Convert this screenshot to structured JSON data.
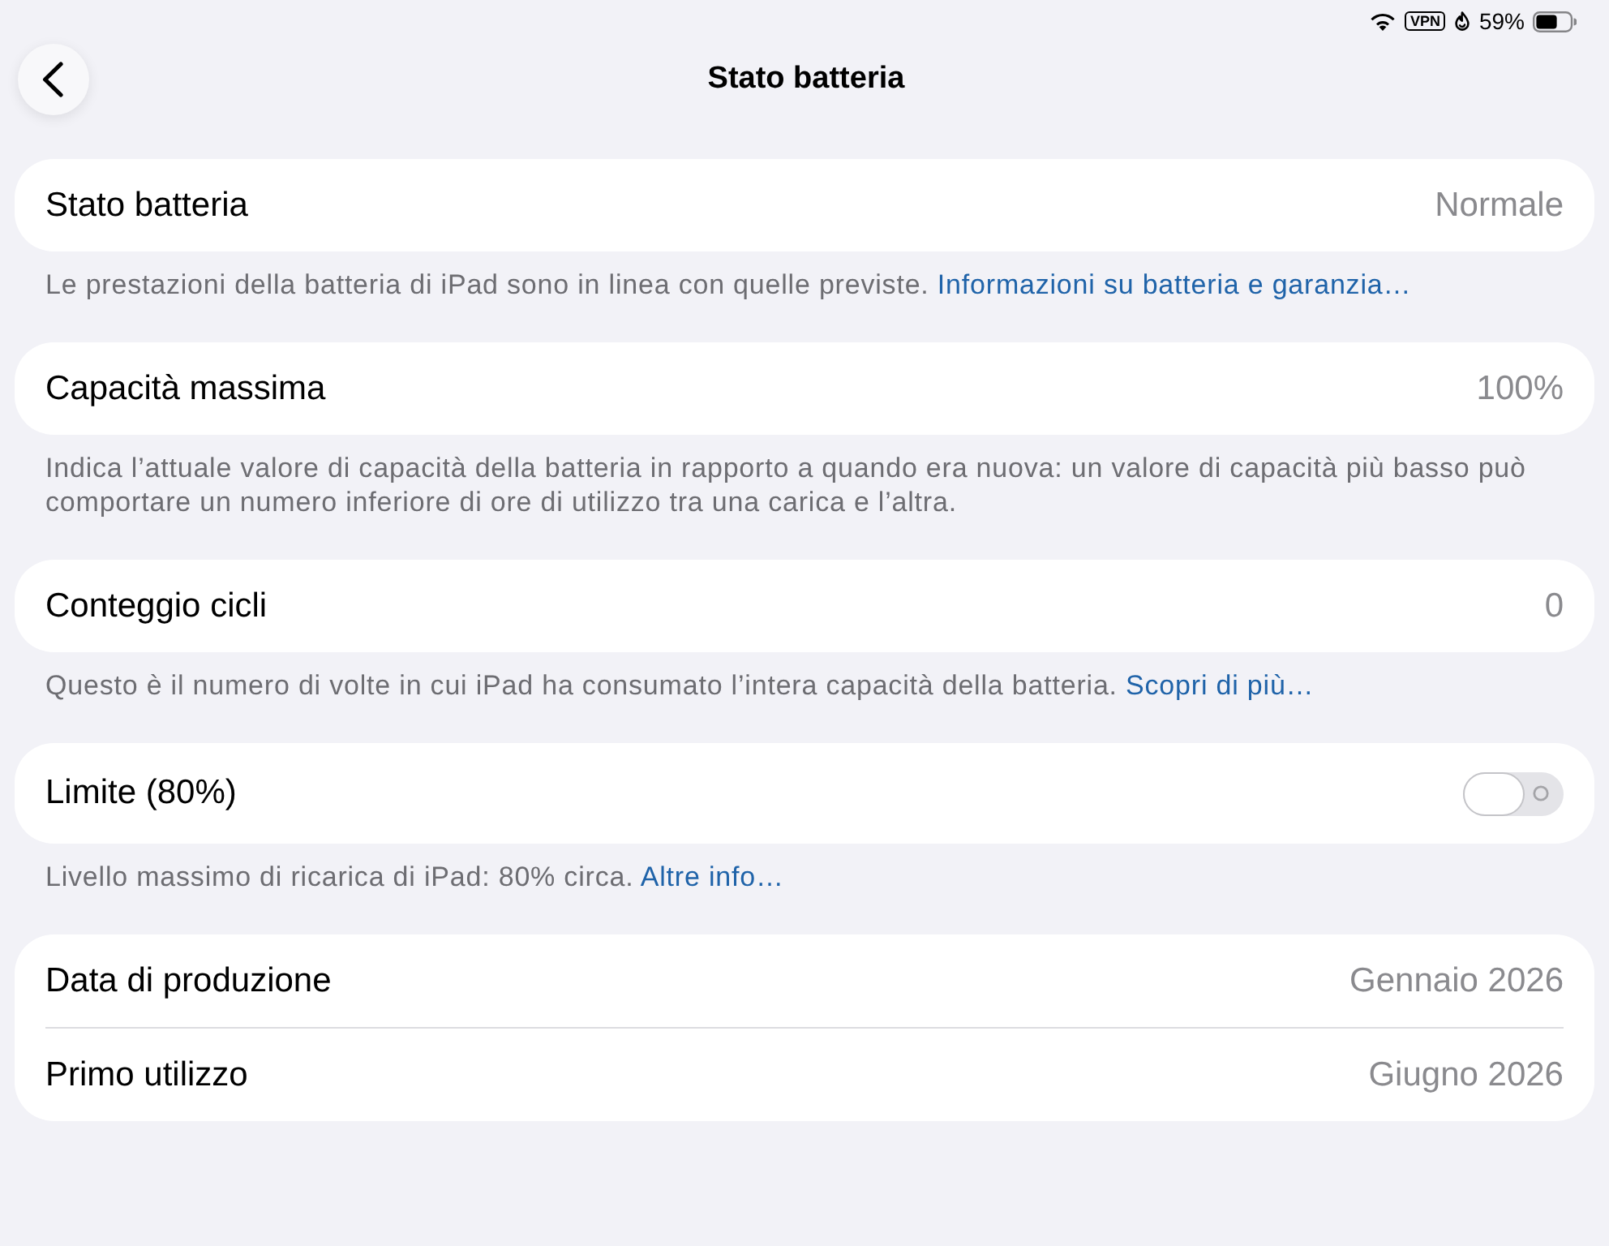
{
  "status_bar": {
    "vpn_label": "VPN",
    "battery_percent": "59%"
  },
  "header": {
    "title": "Stato batteria"
  },
  "groups": [
    {
      "rows": [
        {
          "kind": "value",
          "label": "Stato batteria",
          "value": "Normale"
        }
      ],
      "footer": {
        "text": "Le prestazioni della batteria di iPad sono in linea con quelle previste.",
        "link": "Informazioni su batteria e garanzia…"
      }
    },
    {
      "rows": [
        {
          "kind": "value",
          "label": "Capacità massima",
          "value": "100%"
        }
      ],
      "footer": {
        "text": "Indica l’attuale valore di capacità della batteria in rapporto a quando era nuova: un valore di capacità più basso può comportare un numero inferiore di ore di utilizzo tra una carica e l’altra."
      }
    },
    {
      "rows": [
        {
          "kind": "value",
          "label": "Conteggio cicli",
          "value": "0"
        }
      ],
      "footer": {
        "text": "Questo è il numero di volte in cui iPad ha consumato l’intera capacità della batteria.",
        "link": "Scopri di più…"
      }
    },
    {
      "rows": [
        {
          "kind": "toggle",
          "label": "Limite (80%)",
          "on": false
        }
      ],
      "footer": {
        "text": "Livello massimo di ricarica di iPad: 80% circa.",
        "link": "Altre info…"
      }
    },
    {
      "rows": [
        {
          "kind": "value",
          "label": "Data di produzione",
          "value": "Gennaio 2026"
        },
        {
          "kind": "value",
          "label": "Primo utilizzo",
          "value": "Giugno 2026"
        }
      ]
    }
  ]
}
